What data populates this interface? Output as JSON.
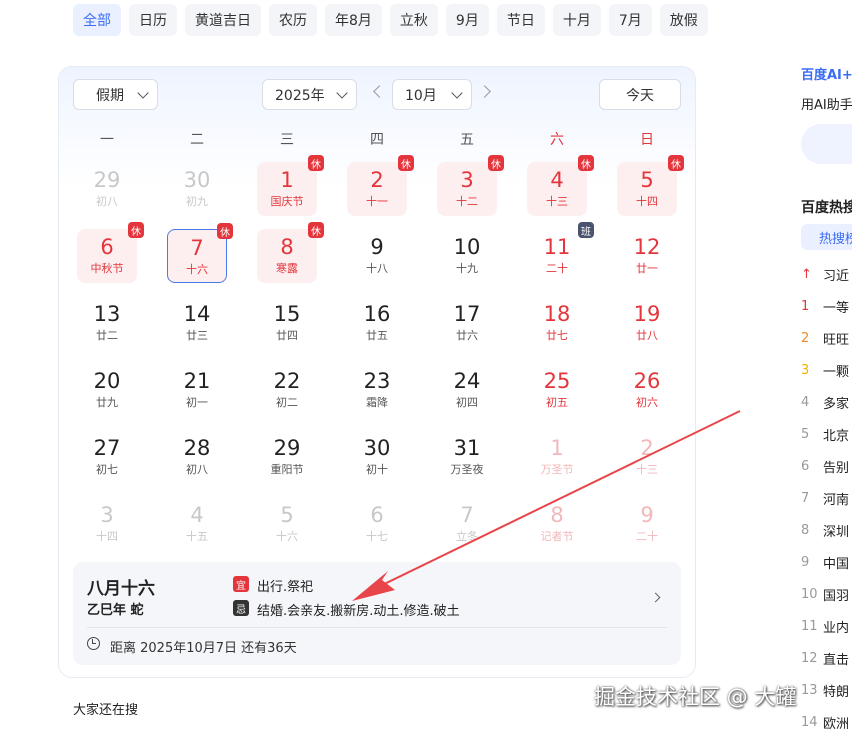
{
  "tabs": [
    "全部",
    "日历",
    "黄道吉日",
    "农历",
    "年8月",
    "立秋",
    "9月",
    "节日",
    "十月",
    "7月",
    "放假"
  ],
  "controls": {
    "holiday_select": "假期",
    "year_select": "2025年",
    "month_select": "10月",
    "today_button": "今天"
  },
  "weekdays": [
    "一",
    "二",
    "三",
    "四",
    "五",
    "六",
    "日"
  ],
  "calendar": [
    [
      {
        "day": "29",
        "lunar": "初八",
        "other": true
      },
      {
        "day": "30",
        "lunar": "初九",
        "other": true
      },
      {
        "day": "1",
        "lunar": "国庆节",
        "badge": "休"
      },
      {
        "day": "2",
        "lunar": "十一",
        "badge": "休"
      },
      {
        "day": "3",
        "lunar": "十二",
        "badge": "休"
      },
      {
        "day": "4",
        "lunar": "十三",
        "badge": "休"
      },
      {
        "day": "5",
        "lunar": "十四",
        "badge": "休"
      }
    ],
    [
      {
        "day": "6",
        "lunar": "中秋节",
        "badge": "休"
      },
      {
        "day": "7",
        "lunar": "十六",
        "badge": "休",
        "selected": true
      },
      {
        "day": "8",
        "lunar": "寒露",
        "badge": "休"
      },
      {
        "day": "9",
        "lunar": "十八"
      },
      {
        "day": "10",
        "lunar": "十九"
      },
      {
        "day": "11",
        "lunar": "二十",
        "badge": "班"
      },
      {
        "day": "12",
        "lunar": "廿一"
      }
    ],
    [
      {
        "day": "13",
        "lunar": "廿二"
      },
      {
        "day": "14",
        "lunar": "廿三"
      },
      {
        "day": "15",
        "lunar": "廿四"
      },
      {
        "day": "16",
        "lunar": "廿五"
      },
      {
        "day": "17",
        "lunar": "廿六"
      },
      {
        "day": "18",
        "lunar": "廿七"
      },
      {
        "day": "19",
        "lunar": "廿八"
      }
    ],
    [
      {
        "day": "20",
        "lunar": "廿九"
      },
      {
        "day": "21",
        "lunar": "初一"
      },
      {
        "day": "22",
        "lunar": "初二"
      },
      {
        "day": "23",
        "lunar": "霜降"
      },
      {
        "day": "24",
        "lunar": "初四"
      },
      {
        "day": "25",
        "lunar": "初五"
      },
      {
        "day": "26",
        "lunar": "初六"
      }
    ],
    [
      {
        "day": "27",
        "lunar": "初七"
      },
      {
        "day": "28",
        "lunar": "初八"
      },
      {
        "day": "29",
        "lunar": "重阳节"
      },
      {
        "day": "30",
        "lunar": "初十"
      },
      {
        "day": "31",
        "lunar": "万圣夜"
      },
      {
        "day": "1",
        "lunar": "万圣节",
        "other": true
      },
      {
        "day": "2",
        "lunar": "十三",
        "other": true
      }
    ],
    [
      {
        "day": "3",
        "lunar": "十四",
        "other": true
      },
      {
        "day": "4",
        "lunar": "十五",
        "other": true
      },
      {
        "day": "5",
        "lunar": "十六",
        "other": true
      },
      {
        "day": "6",
        "lunar": "十七",
        "other": true
      },
      {
        "day": "7",
        "lunar": "立冬",
        "other": true
      },
      {
        "day": "8",
        "lunar": "记者节",
        "other": true
      },
      {
        "day": "9",
        "lunar": "二十",
        "other": true
      }
    ]
  ],
  "info": {
    "lunar_date": "八月十六",
    "ganzhi": "乙巳年 蛇",
    "yi_tag": "宜",
    "yi": "出行.祭祀",
    "ji_tag": "忌",
    "ji": "结婚.会亲友.搬新房.动土.修造.破土",
    "countdown": "距离 2025年10月7日 还有36天"
  },
  "also_search": "大家还在搜",
  "sidebar": {
    "ai_brand": "百度AI+",
    "ai_desc": "用AI助手",
    "hot_title": "百度热搜",
    "hot_tab": "热搜榜",
    "hot_items": [
      {
        "rank": "↑",
        "text": "习近"
      },
      {
        "rank": "1",
        "text": "一等"
      },
      {
        "rank": "2",
        "text": "旺旺"
      },
      {
        "rank": "3",
        "text": "一颗"
      },
      {
        "rank": "4",
        "text": "多家"
      },
      {
        "rank": "5",
        "text": "北京"
      },
      {
        "rank": "6",
        "text": "告别"
      },
      {
        "rank": "7",
        "text": "河南"
      },
      {
        "rank": "8",
        "text": "深圳"
      },
      {
        "rank": "9",
        "text": "中国"
      },
      {
        "rank": "10",
        "text": "国羽"
      },
      {
        "rank": "11",
        "text": "业内"
      },
      {
        "rank": "12",
        "text": "直击"
      },
      {
        "rank": "13",
        "text": "特朗"
      },
      {
        "rank": "14",
        "text": "欧洲"
      }
    ],
    "rank_colors": [
      "#e3353b",
      "#e3353b",
      "#f08a24",
      "#f0b400"
    ]
  },
  "watermark": "掘金技术社区 @ 大罐",
  "colors": {
    "accent": "#3b6cf6",
    "holiday_red": "#e3353b",
    "workday_badge": "#4a5470",
    "annotation_arrow": "#e8454a"
  }
}
